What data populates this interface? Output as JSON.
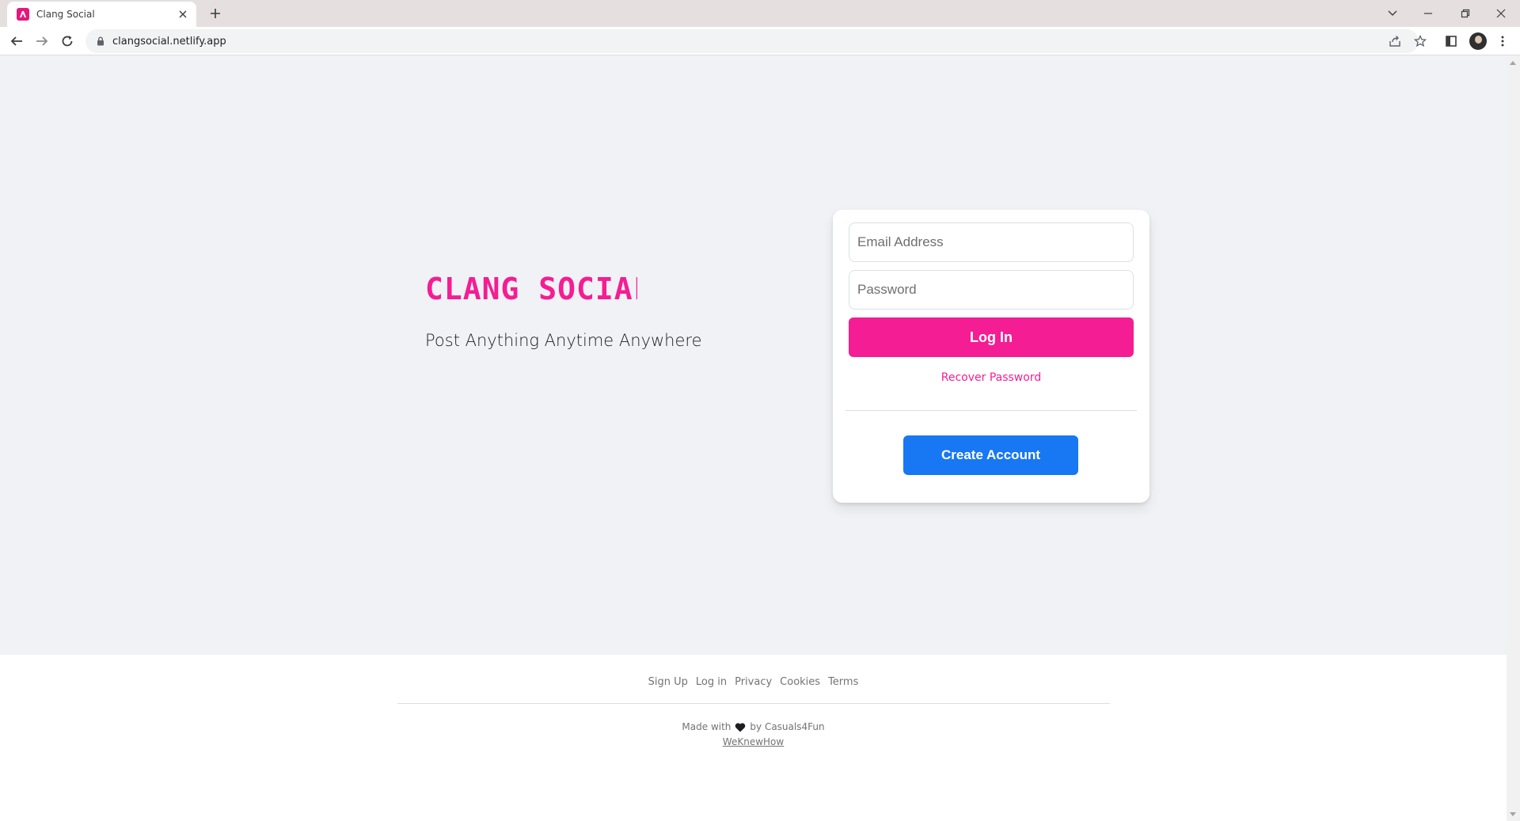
{
  "browser": {
    "tab_title": "Clang Social",
    "url": "clangsocial.netlify.app",
    "icons": [
      "favicon-icon",
      "close-icon",
      "plus-icon",
      "chevron-down-icon",
      "minimize-icon",
      "restore-icon",
      "close-window-icon",
      "back-icon",
      "forward-icon",
      "reload-icon",
      "lock-icon",
      "share-icon",
      "star-icon",
      "side-panel-icon",
      "avatar",
      "menu-icon"
    ]
  },
  "brand": {
    "logo_text": "CLANG SOCIAL",
    "tagline": "Post Anything Anytime Anywhere",
    "accent_color": "#f51d93"
  },
  "login": {
    "email_placeholder": "Email Address",
    "password_placeholder": "Password",
    "login_label": "Log In",
    "recover_label": "Recover Password",
    "create_label": "Create Account",
    "create_color": "#1877f2"
  },
  "footer": {
    "links": [
      "Sign Up",
      "Log in",
      "Privacy",
      "Cookies",
      "Terms"
    ],
    "made_with": "Made with",
    "by": "by Casuals4Fun",
    "studio": "WeKnewHow"
  }
}
